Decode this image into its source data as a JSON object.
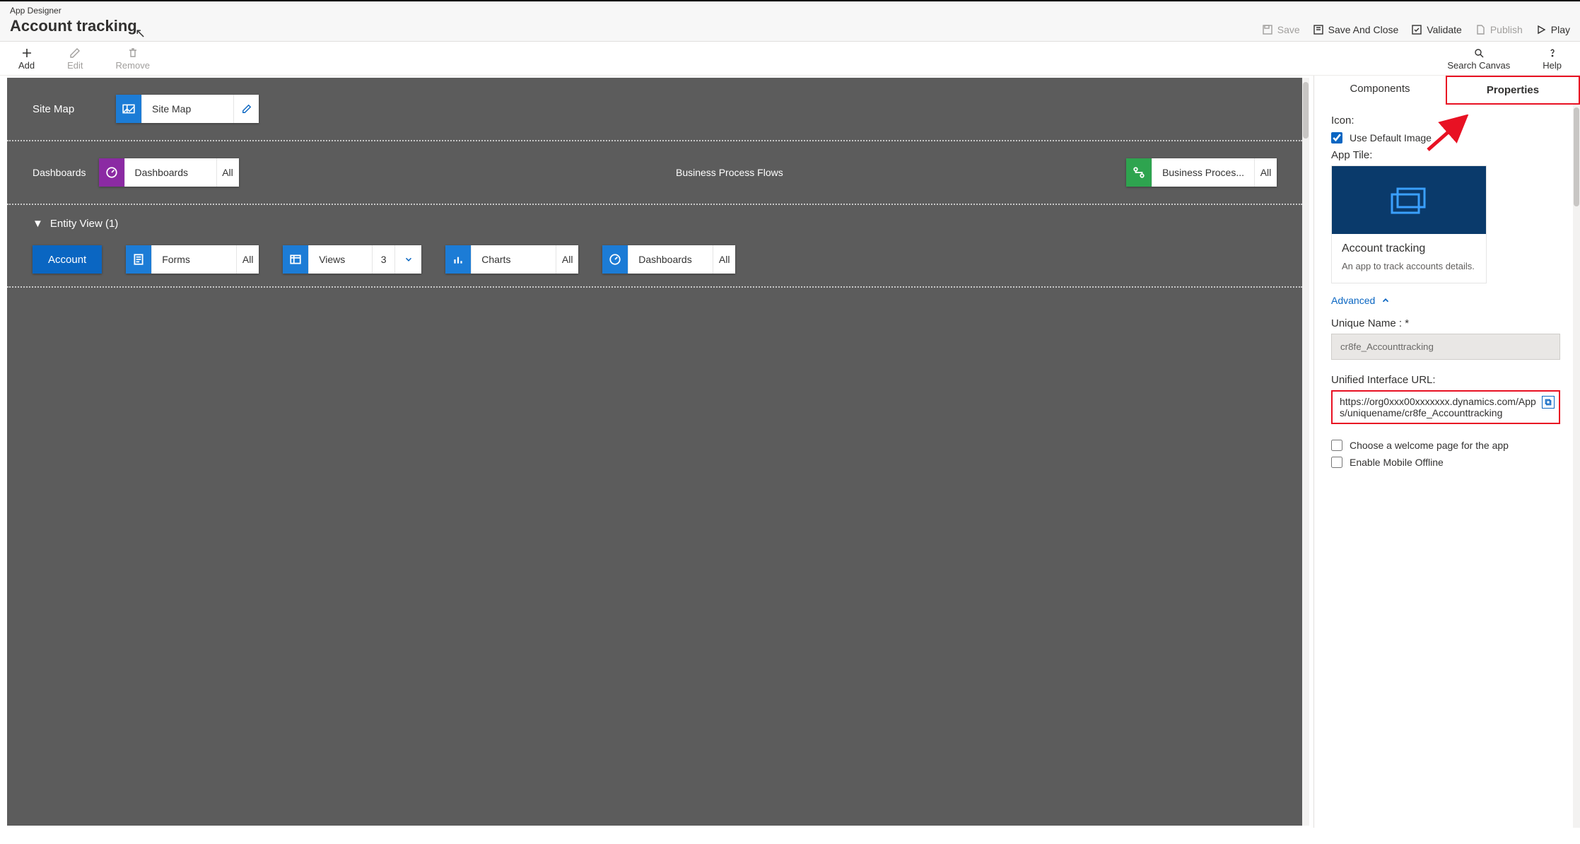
{
  "header": {
    "designer": "App Designer",
    "app_name": "Account tracking",
    "cmds": {
      "save": "Save",
      "save_close": "Save And Close",
      "validate": "Validate",
      "publish": "Publish",
      "play": "Play"
    }
  },
  "toolbar": {
    "add": "Add",
    "edit": "Edit",
    "remove": "Remove",
    "search": "Search Canvas",
    "help": "Help"
  },
  "canvas": {
    "sitemap": {
      "label": "Site Map",
      "block": "Site Map"
    },
    "dashboards": {
      "label": "Dashboards",
      "block": "Dashboards",
      "badge": "All"
    },
    "bpf": {
      "label": "Business Process Flows",
      "block": "Business Proces...",
      "badge": "All"
    },
    "entity_header": "Entity View (1)",
    "entity": {
      "name": "Account",
      "forms": {
        "label": "Forms",
        "badge": "All"
      },
      "views": {
        "label": "Views",
        "badge": "3"
      },
      "charts": {
        "label": "Charts",
        "badge": "All"
      },
      "dash": {
        "label": "Dashboards",
        "badge": "All"
      }
    }
  },
  "side": {
    "tab_components": "Components",
    "tab_properties": "Properties",
    "icon_label": "Icon:",
    "use_default": "Use Default Image",
    "apptile_label": "App Tile:",
    "tile_title": "Account tracking",
    "tile_desc": "An app to track accounts details.",
    "advanced": "Advanced",
    "unique_label": "Unique Name : *",
    "unique_value": "cr8fe_Accounttracking",
    "url_label": "Unified Interface URL:",
    "url_value": "https://org0xxx00xxxxxxx.dynamics.com/Apps/uniquename/cr8fe_Accounttracking",
    "welcome": "Choose a welcome page for the app",
    "offline": "Enable Mobile Offline"
  }
}
